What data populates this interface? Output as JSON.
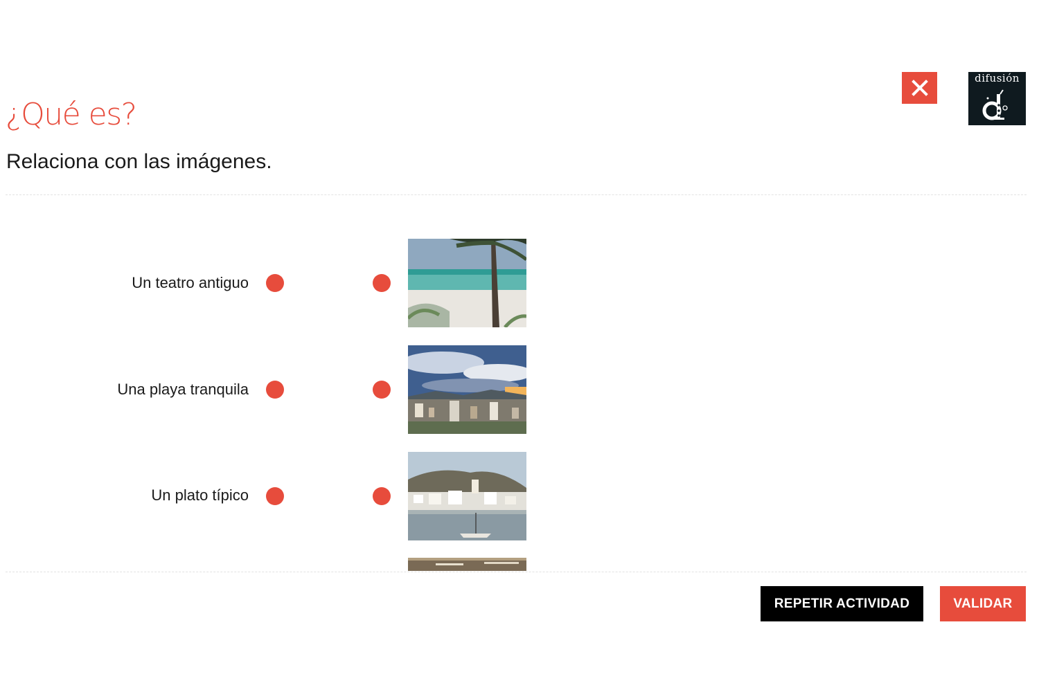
{
  "header": {
    "title": "¿Qué es?",
    "instructions": "Relaciona con las imágenes.",
    "close_icon": "close-icon",
    "logo_text": "difusión"
  },
  "activity": {
    "left_items": [
      {
        "label": "Un teatro antiguo"
      },
      {
        "label": "Una playa tranquila"
      },
      {
        "label": "Un plato típico"
      }
    ],
    "right_images": [
      {
        "name": "beach-palm-image"
      },
      {
        "name": "city-skyline-image"
      },
      {
        "name": "coastal-village-image"
      },
      {
        "name": "partial-image"
      }
    ]
  },
  "footer": {
    "repeat_label": "REPETIR ACTIVIDAD",
    "validate_label": "VALIDAR"
  },
  "colors": {
    "accent": "#e74c3c",
    "dark": "#000000",
    "logo_bg": "#0f1a1f"
  }
}
